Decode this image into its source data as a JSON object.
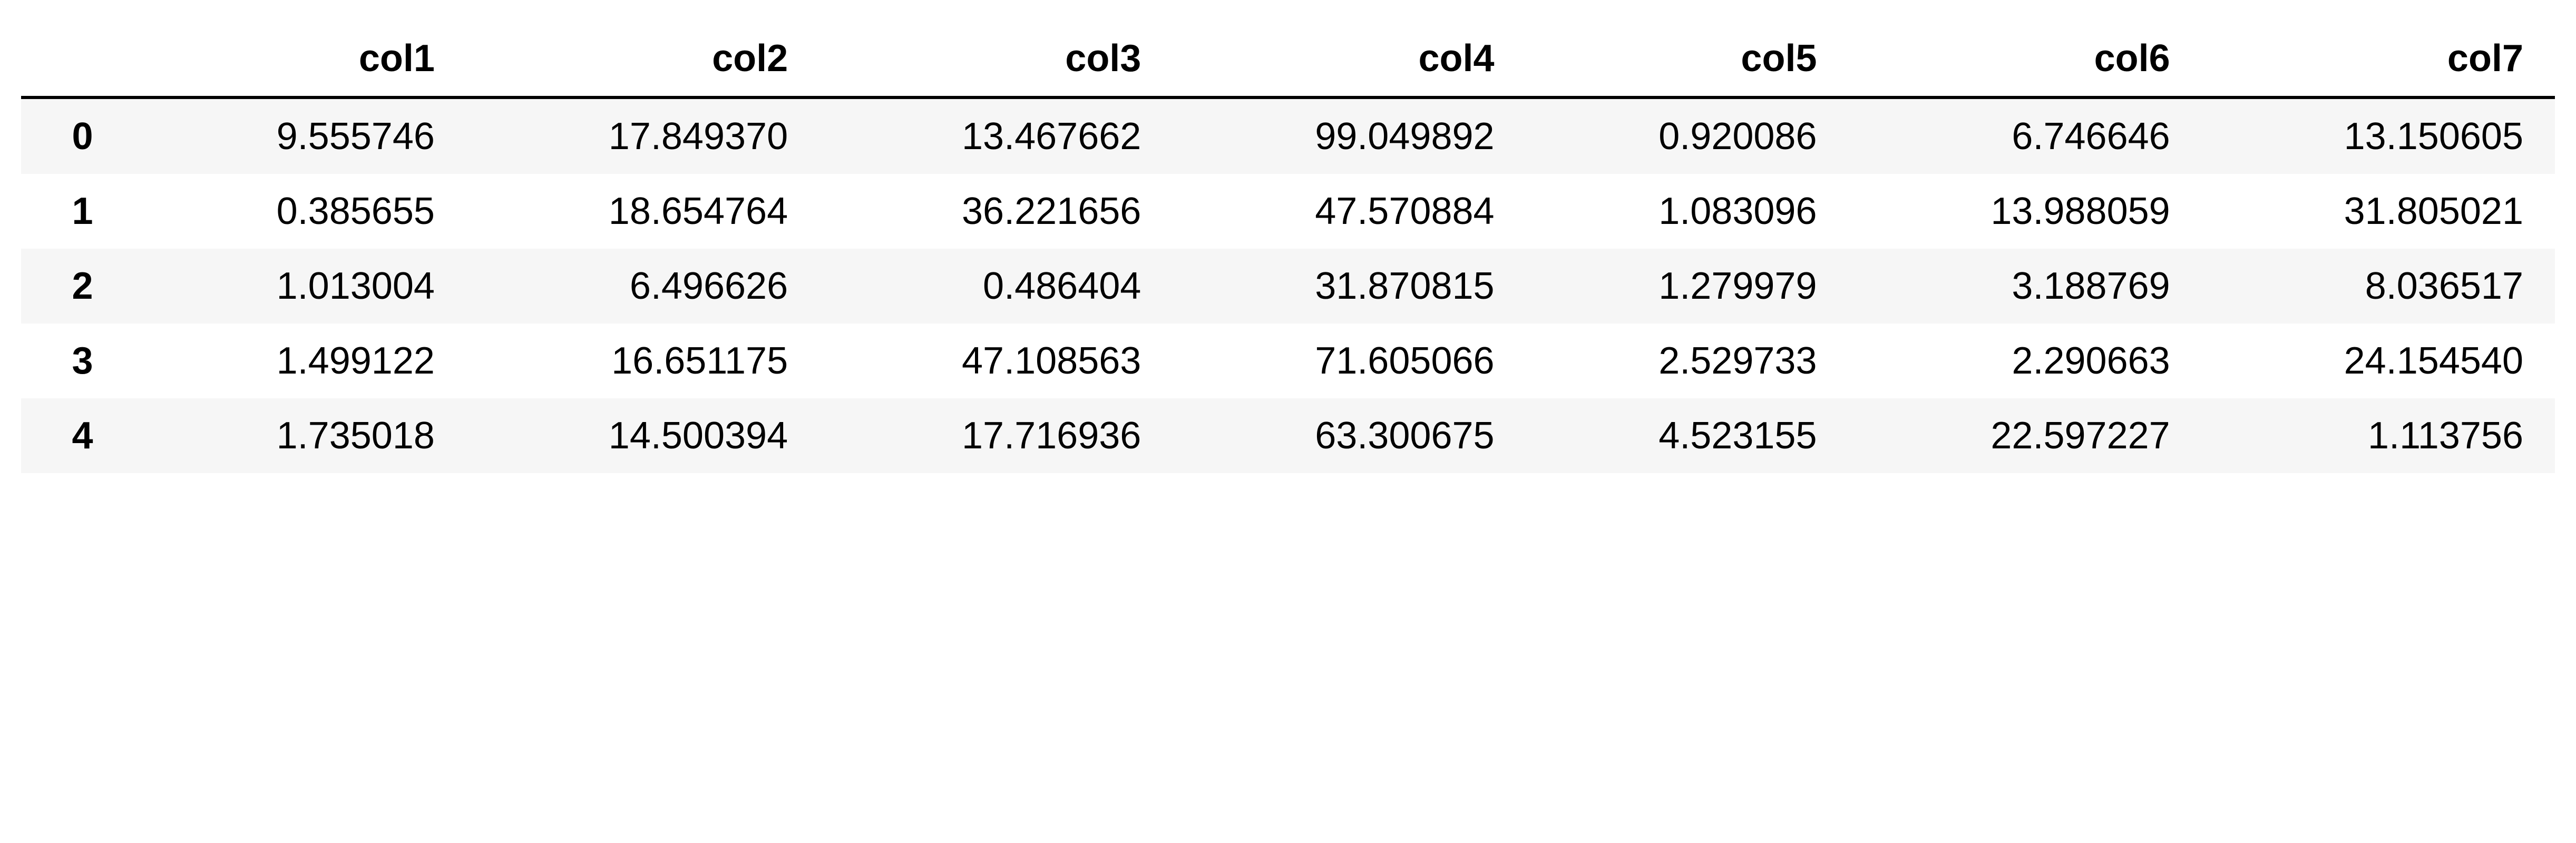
{
  "chart_data": {
    "type": "table",
    "columns": [
      "col1",
      "col2",
      "col3",
      "col4",
      "col5",
      "col6",
      "col7"
    ],
    "index": [
      "0",
      "1",
      "2",
      "3",
      "4"
    ],
    "rows": [
      [
        "9.555746",
        "17.849370",
        "13.467662",
        "99.049892",
        "0.920086",
        "6.746646",
        "13.150605"
      ],
      [
        "0.385655",
        "18.654764",
        "36.221656",
        "47.570884",
        "1.083096",
        "13.988059",
        "31.805021"
      ],
      [
        "1.013004",
        "6.496626",
        "0.486404",
        "31.870815",
        "1.279979",
        "3.188769",
        "8.036517"
      ],
      [
        "1.499122",
        "16.651175",
        "47.108563",
        "71.605066",
        "2.529733",
        "2.290663",
        "24.154540"
      ],
      [
        "1.735018",
        "14.500394",
        "17.716936",
        "63.300675",
        "4.523155",
        "22.597227",
        "1.113756"
      ]
    ]
  }
}
